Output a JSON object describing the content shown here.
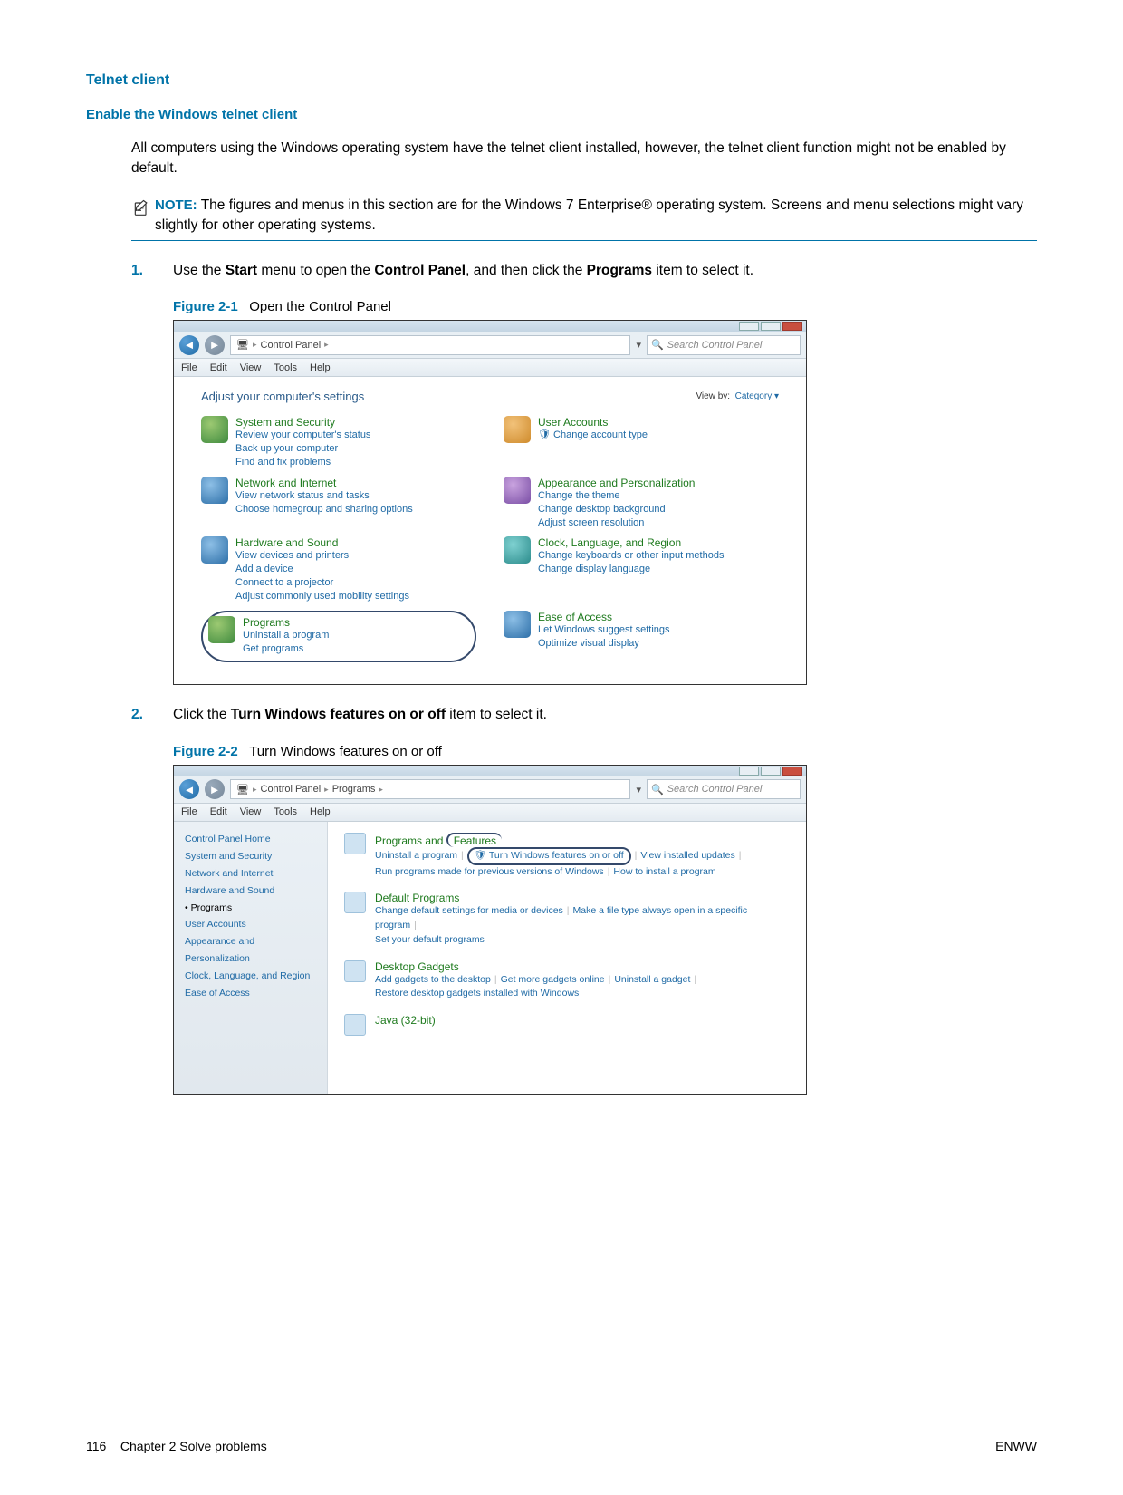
{
  "headings": {
    "telnet": "Telnet client",
    "enable": "Enable the Windows telnet client"
  },
  "para1": "All computers using the Windows operating system have the telnet client installed, however, the telnet client function might not be enabled by default.",
  "note": {
    "label": "NOTE:",
    "text": "The figures and menus in this section are for the Windows 7 Enterprise® operating system. Screens and menu selections might vary slightly for other operating systems."
  },
  "steps": {
    "s1": {
      "num": "1.",
      "pre": "Use the ",
      "b1": "Start",
      "mid1": " menu to open the ",
      "b2": "Control Panel",
      "mid2": ", and then click the ",
      "b3": "Programs",
      "post": " item to select it."
    },
    "s2": {
      "num": "2.",
      "pre": "Click the ",
      "b1": "Turn Windows features on or off",
      "post": " item to select it."
    }
  },
  "fig1": {
    "label": "Figure 2-1",
    "caption": "Open the Control Panel"
  },
  "fig2": {
    "label": "Figure 2-2",
    "caption": "Turn Windows features on or off"
  },
  "win": {
    "menus": [
      "File",
      "Edit",
      "View",
      "Tools",
      "Help"
    ],
    "search_ph": "Search Control Panel"
  },
  "cp1": {
    "crumbs": [
      "Control Panel"
    ],
    "title": "Adjust your computer's settings",
    "viewby_label": "View by:",
    "viewby_value": "Category ▾",
    "items": [
      {
        "h": "System and Security",
        "links": [
          "Review your computer's status",
          "Back up your computer",
          "Find and fix problems"
        ]
      },
      {
        "h": "User Accounts",
        "links": [
          "Change account type"
        ],
        "icon_note": "🛡"
      },
      {
        "h": "Network and Internet",
        "links": [
          "View network status and tasks",
          "Choose homegroup and sharing options"
        ]
      },
      {
        "h": "Appearance and Personalization",
        "links": [
          "Change the theme",
          "Change desktop background",
          "Adjust screen resolution"
        ]
      },
      {
        "h": "Hardware and Sound",
        "links": [
          "View devices and printers",
          "Add a device",
          "Connect to a projector",
          "Adjust commonly used mobility settings"
        ]
      },
      {
        "h": "Clock, Language, and Region",
        "links": [
          "Change keyboards or other input methods",
          "Change display language"
        ]
      },
      {
        "h": "Programs",
        "links": [
          "Uninstall a program",
          "Get programs"
        ],
        "circled": true
      },
      {
        "h": "Ease of Access",
        "links": [
          "Let Windows suggest settings",
          "Optimize visual display"
        ]
      }
    ]
  },
  "cp2": {
    "crumbs": [
      "Control Panel",
      "Programs"
    ],
    "leftnav": [
      "Control Panel Home",
      "System and Security",
      "Network and Internet",
      "Hardware and Sound",
      "Programs",
      "User Accounts",
      "Appearance and Personalization",
      "Clock, Language, and Region",
      "Ease of Access"
    ],
    "leftnav_current_index": 4,
    "groups": [
      {
        "h": "Programs and Features",
        "links": [
          "Uninstall a program",
          "Turn Windows features on or off",
          "View installed updates",
          "Run programs made for previous versions of Windows",
          "How to install a program"
        ],
        "circled_link_index": 1,
        "shield_link_index": 1
      },
      {
        "h": "Default Programs",
        "links": [
          "Change default settings for media or devices",
          "Make a file type always open in a specific program",
          "Set your default programs"
        ]
      },
      {
        "h": "Desktop Gadgets",
        "links": [
          "Add gadgets to the desktop",
          "Get more gadgets online",
          "Uninstall a gadget",
          "Restore desktop gadgets installed with Windows"
        ]
      },
      {
        "h": "Java (32-bit)",
        "links": []
      }
    ]
  },
  "footer": {
    "left_page": "116",
    "left_chapter": "Chapter 2   Solve problems",
    "right": "ENWW"
  }
}
